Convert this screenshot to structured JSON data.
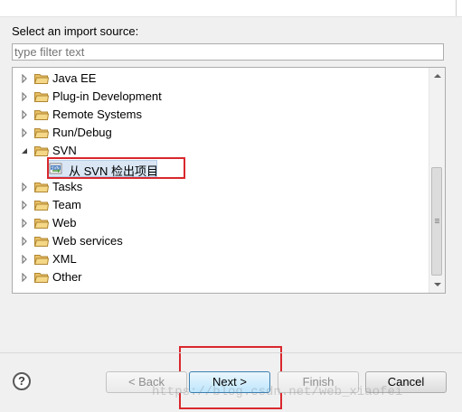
{
  "dialog": {
    "prompt": "Select an import source:",
    "filter_placeholder": "type filter text"
  },
  "tree": {
    "items": [
      {
        "label": "Java EE",
        "expanded": false
      },
      {
        "label": "Plug-in Development",
        "expanded": false
      },
      {
        "label": "Remote Systems",
        "expanded": false
      },
      {
        "label": "Run/Debug",
        "expanded": false
      },
      {
        "label": "SVN",
        "expanded": true
      },
      {
        "label": "从 SVN 检出项目",
        "child": true,
        "selected": true
      },
      {
        "label": "Tasks",
        "expanded": false
      },
      {
        "label": "Team",
        "expanded": false
      },
      {
        "label": "Web",
        "expanded": false
      },
      {
        "label": "Web services",
        "expanded": false
      },
      {
        "label": "XML",
        "expanded": false
      },
      {
        "label": "Other",
        "expanded": false
      }
    ]
  },
  "buttons": {
    "help": "?",
    "back": "< Back",
    "next": "Next >",
    "finish": "Finish",
    "cancel": "Cancel"
  },
  "watermark": "https://blog.csdn.net/web_xiaofei",
  "colors": {
    "highlight_box": "#d9282d",
    "selection_bg": "#dae6f4",
    "default_button_border": "#3c7fb1"
  }
}
